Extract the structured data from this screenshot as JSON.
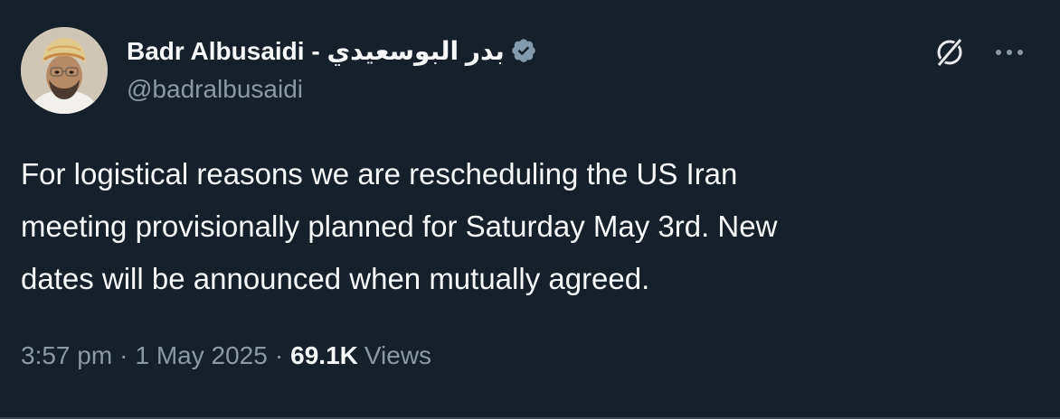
{
  "author": {
    "display_name": "Badr Albusaidi - بدر البوسعيدي",
    "handle": "@badralbusaidi",
    "verified": true
  },
  "actions": {
    "grok_icon": "grok-slash-circle-icon",
    "more_icon": "more-horizontal-icon"
  },
  "tweet": {
    "text_lines": [
      "For logistical reasons we are rescheduling the US Iran",
      "meeting provisionally planned for Saturday May 3rd. New",
      "dates will be announced when mutually agreed."
    ]
  },
  "meta": {
    "time": "3:57 pm",
    "separator": "·",
    "date": "1 May 2025",
    "views_count": "69.1K",
    "views_label": "Views"
  },
  "colors": {
    "background": "#15202b",
    "text_primary": "#f7f9f9",
    "text_secondary": "#8b98a5",
    "verified_badge": "#829aab"
  }
}
